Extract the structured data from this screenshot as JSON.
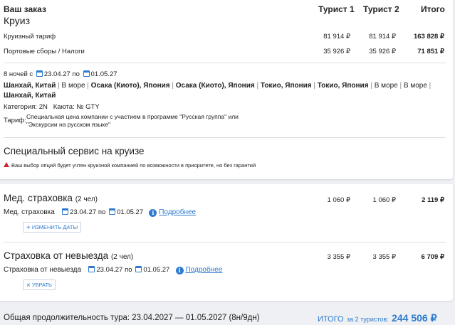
{
  "order": {
    "title": "Ваш заказ",
    "section": "Круиз",
    "col_tourist1": "Турист 1",
    "col_tourist2": "Турист 2",
    "col_total": "Итого"
  },
  "cruise_rows": [
    {
      "label": "Круизный тариф",
      "t1": "81 914 ₽",
      "t2": "81 914 ₽",
      "total": "163 828 ₽"
    },
    {
      "label": "Портовые сборы / Налоги",
      "t1": "35 926 ₽",
      "t2": "35 926 ₽",
      "total": "71 851 ₽"
    }
  ],
  "itinerary": {
    "nights": "8 ночей с",
    "date_from": "23.04.27",
    "by": "по",
    "date_to": "01.05.27",
    "route": [
      {
        "text": "Шанхай, Китай",
        "bold": true
      },
      {
        "text": "В море",
        "bold": false
      },
      {
        "text": "Осака (Киото), Япония",
        "bold": true
      },
      {
        "text": "Осака (Киото), Япония",
        "bold": true
      },
      {
        "text": "Токио, Япония",
        "bold": true
      },
      {
        "text": "Токио, Япония",
        "bold": true
      },
      {
        "text": "В море",
        "bold": false
      },
      {
        "text": "В море",
        "bold": false
      },
      {
        "text": "Шанхай, Китай",
        "bold": true
      }
    ],
    "category": "Категория: 2N",
    "cabin": "Каюта: № GTY",
    "tariff_label": "Тариф:",
    "tariff_line1": "Специальная цена компании с участием в программе \"Русская группа\" или",
    "tariff_line2": "\"Экскурсии на русском языке\""
  },
  "special": {
    "title": "Специальный сервис на круизе",
    "note": "Ваш выбор опций будет учтен круизной компанией по возможности в приоритете, но без гарантий"
  },
  "med": {
    "title": "Мед. страховка",
    "persons": "(2 чел)",
    "t1": "1 060 ₽",
    "t2": "1 060 ₽",
    "total": "2 119 ₽",
    "sub_label": "Мед. страховка",
    "date_from": "23.04.27",
    "by": "по",
    "date_to": "01.05.27",
    "more": "Подробнее",
    "btn": "ИЗМЕНИТЬ ДАТЫ"
  },
  "cancel": {
    "title": "Страховка от невыезда",
    "persons": "(2 чел)",
    "t1": "3 355 ₽",
    "t2": "3 355 ₽",
    "total": "6 709 ₽",
    "sub_label": "Страховка от невыезда",
    "date_from": "23.04.27",
    "by": "по",
    "date_to": "01.05.27",
    "more": "Подробнее",
    "btn": "УБРАТЬ"
  },
  "footer": {
    "duration": "Общая продолжительность тура: 23.04.2027 — 01.05.2027 (8н/9дн)",
    "total_label": "ИТОГО",
    "total_for": "за 2 туристов:",
    "total_value": "244 506 ₽"
  },
  "colors": {
    "accent": "#2e7bcf",
    "warning": "#d0232a"
  }
}
